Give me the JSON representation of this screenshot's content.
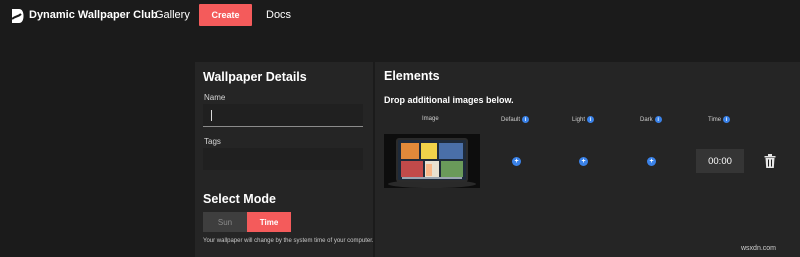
{
  "nav": {
    "brand": "Dynamic Wallpaper Club",
    "gallery": "Gallery",
    "create": "Create",
    "docs": "Docs"
  },
  "details": {
    "title": "Wallpaper Details",
    "name_label": "Name",
    "name_value": "",
    "tags_label": "Tags",
    "tags_value": ""
  },
  "mode": {
    "title": "Select Mode",
    "sun": "Sun",
    "time": "Time",
    "selected": "Time",
    "description": "Your wallpaper will change by the system time of your computer."
  },
  "elements": {
    "title": "Elements",
    "subtitle": "Drop additional images below.",
    "columns": {
      "image": "Image",
      "default": "Default",
      "light": "Light",
      "dark": "Dark",
      "time": "Time"
    },
    "row": {
      "time": "00:00"
    }
  },
  "watermark": "wsxdn.com",
  "colors": {
    "accent": "#f45b5b",
    "info": "#3a82e8",
    "background": "#1b1b1b",
    "panel": "#252525"
  },
  "icons": {
    "logo": "dynamic-wallpaper-logo-icon",
    "info": "info-icon",
    "add": "plus-icon",
    "delete": "trash-icon"
  }
}
